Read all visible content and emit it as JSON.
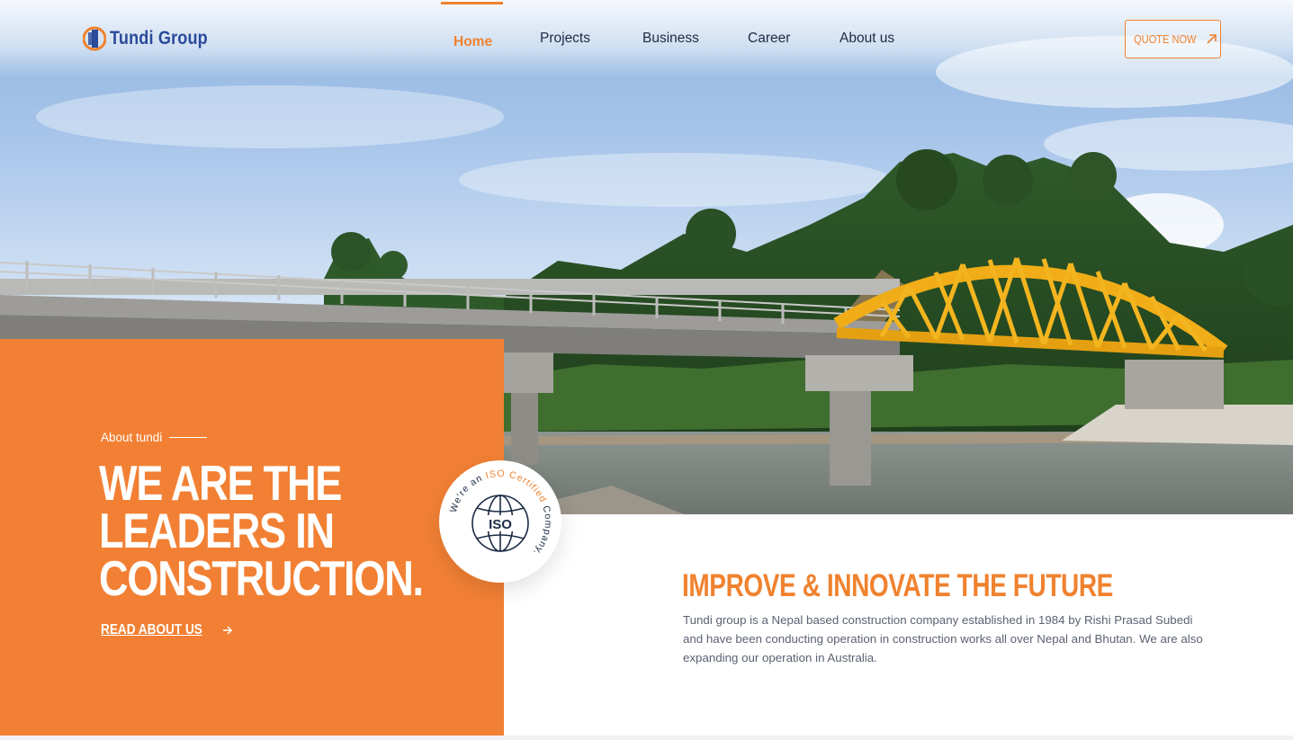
{
  "brand": {
    "name": "Tundi Group",
    "primary_color": "#f0822f",
    "navy_color": "#2a4a9a"
  },
  "nav": {
    "items": [
      {
        "label": "Home",
        "active": true
      },
      {
        "label": "Projects",
        "active": false
      },
      {
        "label": "Business",
        "active": false
      },
      {
        "label": "Career",
        "active": false
      },
      {
        "label": "About us",
        "active": false
      }
    ],
    "cta_label": "QUOTE NOW",
    "cta_icon": "arrow-up-right-icon"
  },
  "hero": {
    "image_subject": "bridge-over-river-icon",
    "about_label": "About tundi",
    "title": "WE ARE THE\nLEADERS IN\nCONSTRUCTION.",
    "read_more_label": "READ ABOUT US",
    "read_more_icon": "arrow-right-icon"
  },
  "badge": {
    "ring_text_prefix": "We're an ",
    "ring_text_highlight": "ISO Certified",
    "ring_text_suffix": " Company.",
    "center_label": "ISO",
    "icon": "globe-icon"
  },
  "intro": {
    "title": "IMPROVE & INNOVATE THE FUTURE",
    "description": "Tundi group is a Nepal based construction company established in 1984 by Rishi Prasad Subedi and have been conducting operation in construction works all over Nepal and Bhutan. We are also expanding our operation in Australia."
  }
}
